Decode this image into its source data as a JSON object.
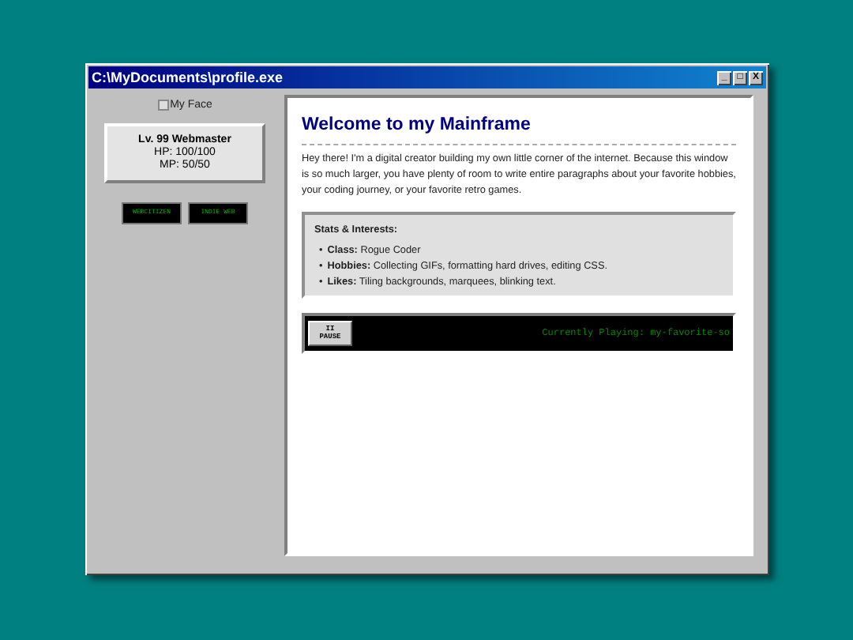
{
  "window": {
    "title": "C:\\MyDocuments\\profile.exe",
    "controls": [
      "_",
      "□",
      "X"
    ]
  },
  "sidebar": {
    "avatar_alt": "My Face",
    "stats": [
      "Lv. 99 Webmaster",
      "HP: 100/100",
      "MP: 50/50"
    ],
    "badges": [
      "WEBCITIZEN",
      "INDIE WEB"
    ]
  },
  "main": {
    "heading": "Welcome to my Mainframe",
    "intro": "Hey there! I'm a digital creator building my own little corner of the internet. Because this window is so much larger, you have plenty of room to write entire paragraphs about your favorite hobbies, your coding journey, or your favorite retro games.",
    "stats_title": "Stats & Interests:",
    "stats": [
      {
        "marker": "•",
        "text": "**Class:** Rogue Coder"
      },
      {
        "marker": "•",
        "text": "**Hobbies:** Collecting GIFs, formatting hard drives, editing CSS."
      },
      {
        "marker": "•",
        "text": "**Likes:** Tiling backgrounds, marquees, blinking text."
      }
    ],
    "player": {
      "button": [
        "II",
        "PAUSE"
      ],
      "now_playing": "Currently Playing: my-favorite-so"
    }
  }
}
